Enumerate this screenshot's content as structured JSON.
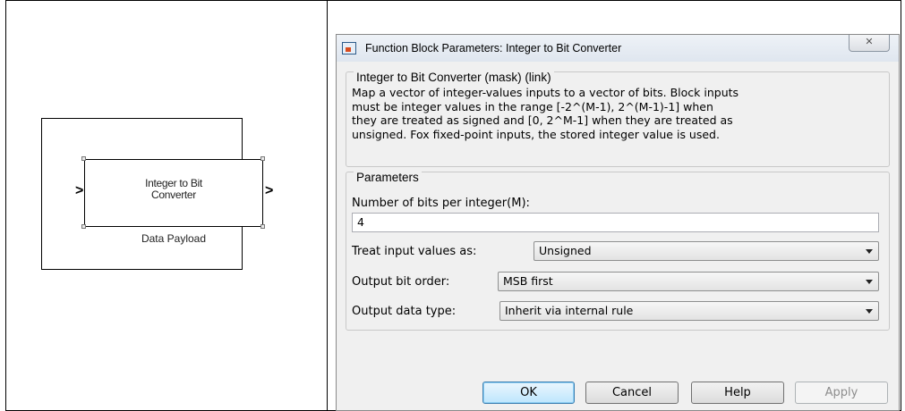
{
  "block": {
    "label_line1": "Integer to Bit",
    "label_line2": "Converter",
    "name": "Data Payload",
    "input_port": ">",
    "output_port": ">"
  },
  "dialog": {
    "title": "Function Block Parameters: Integer to Bit Converter",
    "close_glyph": "✕",
    "mask_group_title": "Integer to Bit Converter (mask) (link)",
    "description_lines": [
      "Map a vector of integer-values inputs to a vector of bits.  Block inputs",
      "must be integer values in the range [-2^(M-1), 2^(M-1)-1]  when",
      "they are treated as signed and [0, 2^M-1] when they are treated as",
      "unsigned.  Fox fixed-point inputs, the stored integer value is used."
    ],
    "parameters_group_title": "Parameters",
    "bits_label": "Number of bits per integer(M):",
    "bits_value": "4",
    "treat_label": "Treat input values as:",
    "treat_value": "Unsigned",
    "order_label": "Output bit order:",
    "order_value": "MSB first",
    "dtype_label": "Output data type:",
    "dtype_value": "Inherit via internal rule",
    "buttons": {
      "ok": "OK",
      "cancel": "Cancel",
      "help": "Help",
      "apply": "Apply"
    }
  }
}
